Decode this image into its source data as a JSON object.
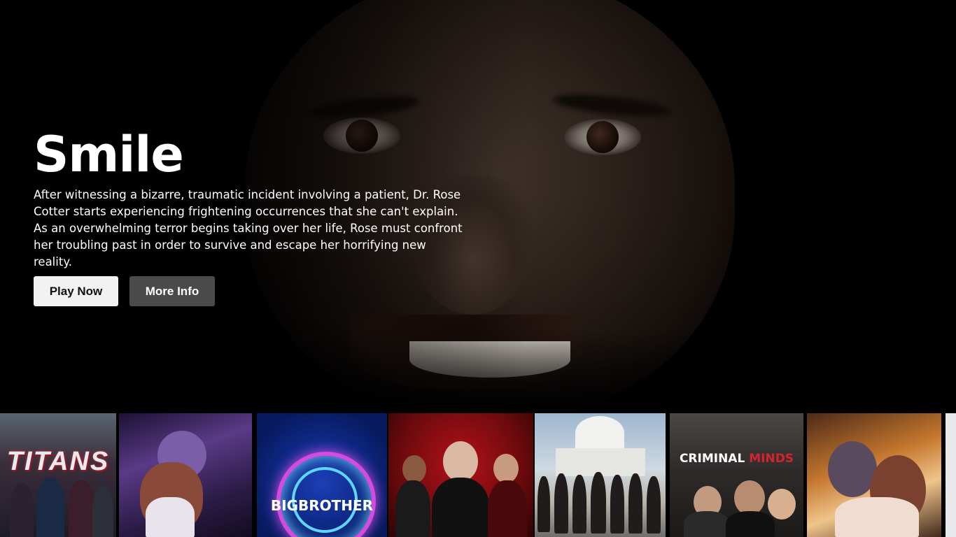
{
  "hero": {
    "title": "Smile",
    "synopsis": "After witnessing a bizarre, traumatic incident involving a patient, Dr. Rose Cotter starts experiencing frightening occurrences that she can't explain. As an overwhelming terror begins taking over her life, Rose must confront her troubling past in order to survive and escape her horrifying new reality.",
    "play_label": "Play Now",
    "info_label": "More Info"
  },
  "row": {
    "posters": [
      {
        "name": "titans",
        "logo": "TITANS"
      },
      {
        "name": "anime-1",
        "logo": ""
      },
      {
        "name": "big-brother",
        "logo": "BIGBROTHER"
      },
      {
        "name": "ensemble-red",
        "logo": ""
      },
      {
        "name": "capitol",
        "logo": ""
      },
      {
        "name": "criminal-minds",
        "logo_white": "CRIMINAL ",
        "logo_red": "MINDS"
      },
      {
        "name": "anime-2",
        "logo": ""
      }
    ]
  },
  "colors": {
    "background": "#000000",
    "play_button": "#f2f2f2",
    "info_button": "#4a4a4a"
  }
}
